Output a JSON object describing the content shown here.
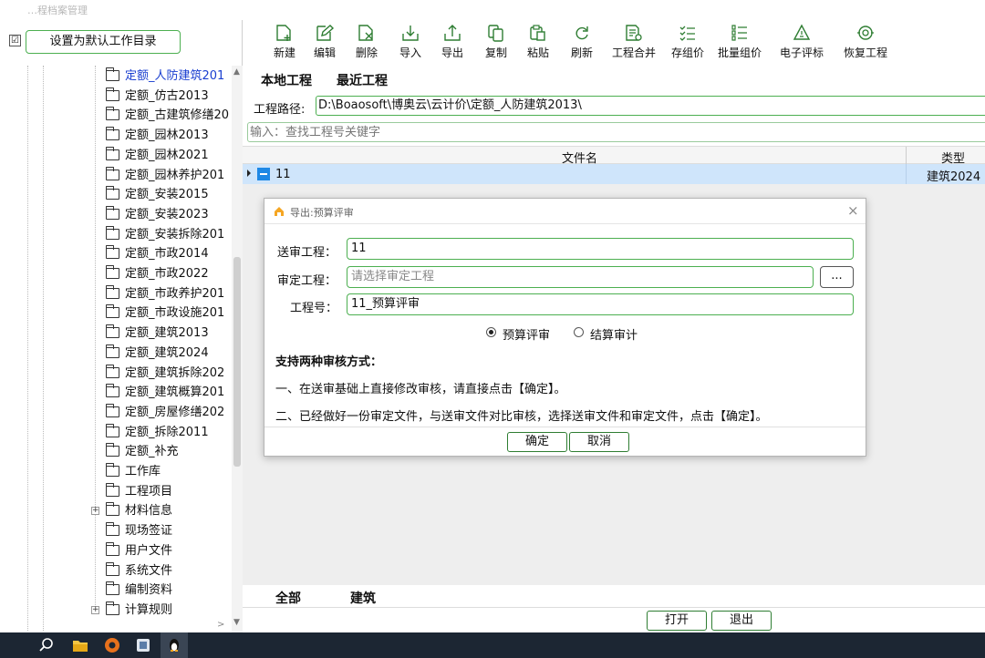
{
  "app": {
    "title": "…程档案管理"
  },
  "sidebar": {
    "set_default_label": "设置为默认工作目录",
    "set_default_checked": "☑",
    "tree": [
      {
        "label": "定额_人防建筑201",
        "selected": true
      },
      {
        "label": "定额_仿古2013"
      },
      {
        "label": "定额_古建筑修缮20"
      },
      {
        "label": "定额_园林2013"
      },
      {
        "label": "定额_园林2021"
      },
      {
        "label": "定额_园林养护201"
      },
      {
        "label": "定额_安装2015"
      },
      {
        "label": "定额_安装2023"
      },
      {
        "label": "定额_安装拆除201"
      },
      {
        "label": "定额_市政2014"
      },
      {
        "label": "定额_市政2022"
      },
      {
        "label": "定额_市政养护201"
      },
      {
        "label": "定额_市政设施201"
      },
      {
        "label": "定额_建筑2013"
      },
      {
        "label": "定额_建筑2024"
      },
      {
        "label": "定额_建筑拆除202"
      },
      {
        "label": "定额_建筑概算201"
      },
      {
        "label": "定额_房屋修缮202"
      },
      {
        "label": "定额_拆除2011"
      },
      {
        "label": "定额_补充"
      },
      {
        "label": "工作库"
      },
      {
        "label": "工程项目"
      },
      {
        "label": "材料信息",
        "expander": "+"
      },
      {
        "label": "现场签证"
      },
      {
        "label": "用户文件"
      },
      {
        "label": "系统文件"
      },
      {
        "label": "编制资料"
      },
      {
        "label": "计算规则",
        "expander": "+"
      }
    ]
  },
  "toolbar": {
    "items": [
      {
        "label": "新建",
        "icon": "new-icon"
      },
      {
        "label": "编辑",
        "icon": "edit-icon"
      },
      {
        "label": "删除",
        "icon": "delete-icon"
      },
      {
        "label": "导入",
        "icon": "import-icon"
      },
      {
        "label": "导出",
        "icon": "export-icon"
      },
      {
        "label": "复制",
        "icon": "copy-icon"
      },
      {
        "label": "粘贴",
        "icon": "paste-icon"
      },
      {
        "label": "刷新",
        "icon": "refresh-icon"
      },
      {
        "label": "工程合并",
        "icon": "merge-icon"
      },
      {
        "label": "存组价",
        "icon": "save-price-icon"
      },
      {
        "label": "批量组价",
        "icon": "batch-price-icon"
      },
      {
        "label": "电子评标",
        "icon": "e-bid-icon"
      },
      {
        "label": "恢复工程",
        "icon": "restore-icon"
      }
    ]
  },
  "main": {
    "tabs": [
      "本地工程",
      "最近工程"
    ],
    "path_label": "工程路径:",
    "path_value": "D:\\Boaosoft\\博奥云\\云计价\\定额_人防建筑2013\\",
    "search_placeholder": "输入：查找工程号关键字",
    "columns": [
      "文件名",
      "类型"
    ],
    "rows": [
      {
        "name": "11",
        "type": "建筑2024"
      }
    ],
    "bottom_tabs": [
      "全部",
      "建筑"
    ],
    "open_label": "打开",
    "exit_label": "退出"
  },
  "dialog": {
    "title": "导出:预算评审",
    "close": "×",
    "submit_label": "送审工程：",
    "submit_value": "11",
    "review_label": "审定工程：",
    "review_placeholder": "请选择审定工程",
    "browse_label": "...",
    "number_label": "工程号：",
    "number_value": "11_预算评审",
    "radio_budget": "预算评审",
    "radio_settle": "结算审计",
    "heading": "支持两种审核方式：",
    "line1": "一、在送审基础上直接修改审核，请直接点击【确定】。",
    "line2": "二、已经做好一份审定文件，与送审文件对比审核，选择送审文件和审定文件，点击【确定】。",
    "ok_label": "确定",
    "cancel_label": "取消"
  },
  "colors": {
    "accent": "#4caf50",
    "selection": "#cfe5fb",
    "taskbar": "#1c2633"
  }
}
